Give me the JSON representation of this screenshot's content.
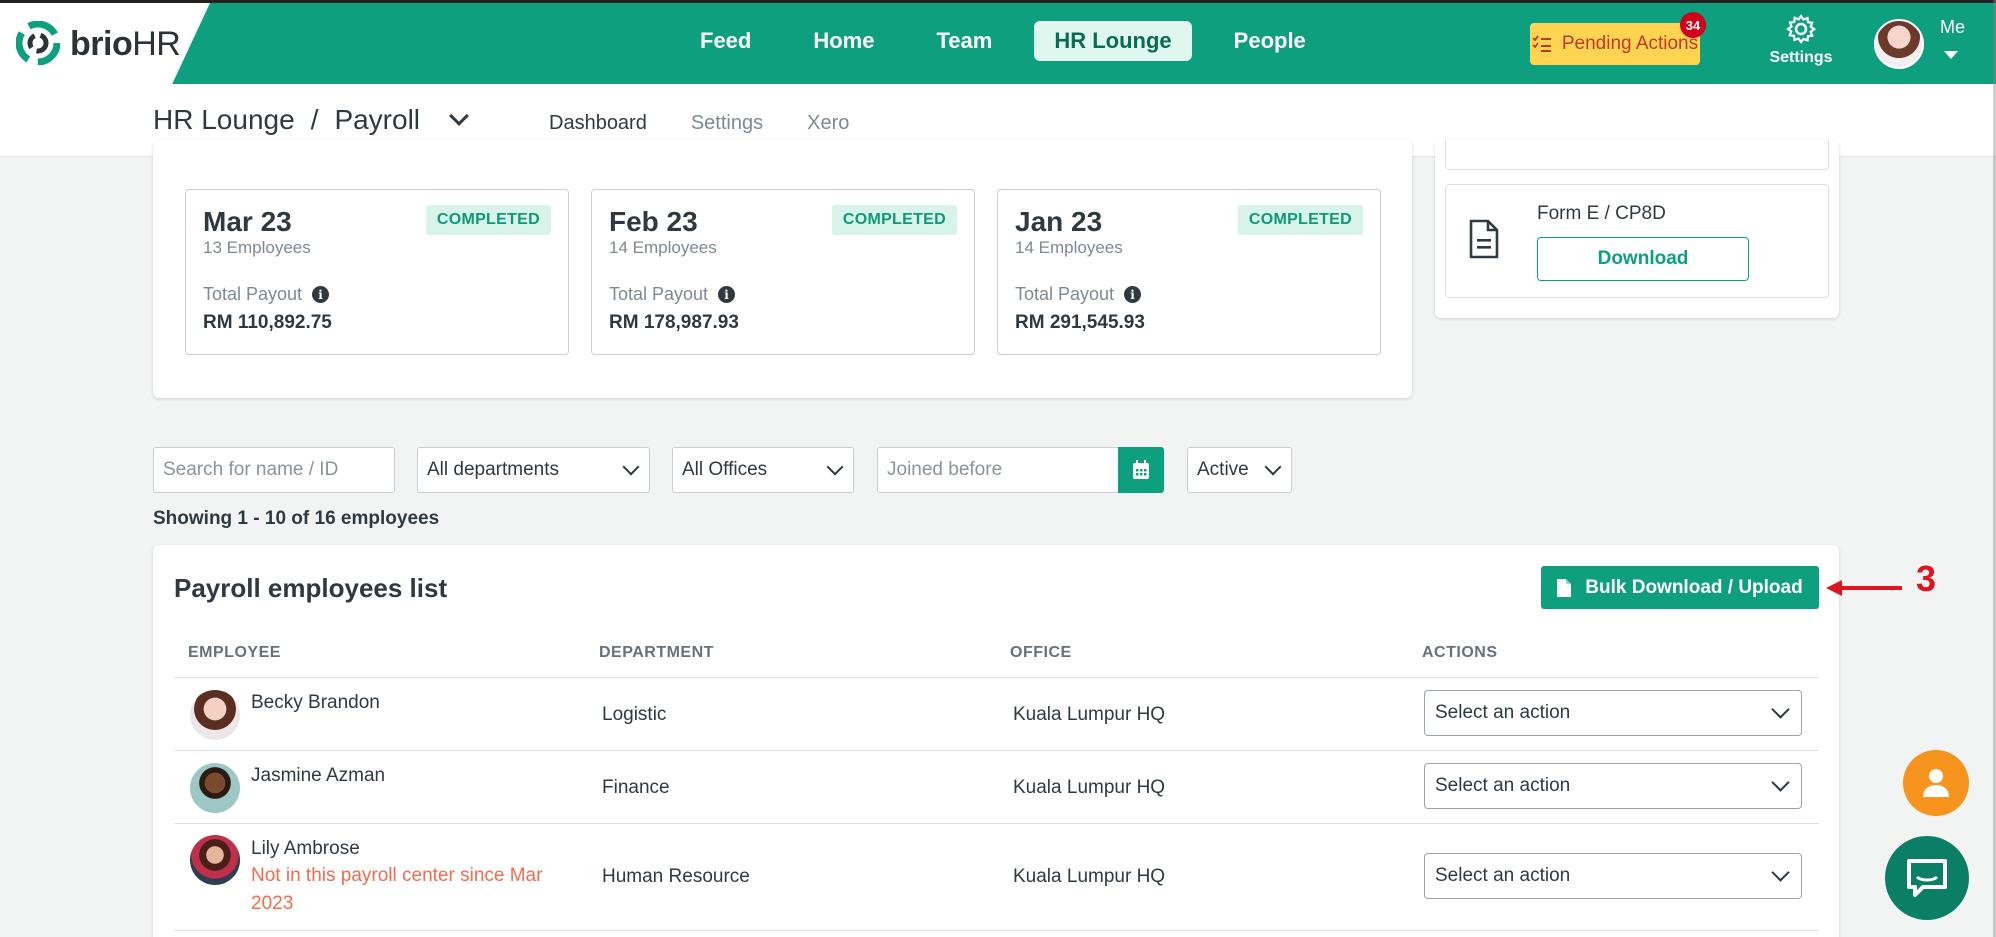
{
  "brand": {
    "name_bold": "brio",
    "name_rest": "HR"
  },
  "nav": {
    "items": [
      "Feed",
      "Home",
      "Team",
      "HR Lounge",
      "People"
    ],
    "active": "HR Lounge"
  },
  "pending_actions": {
    "label": "Pending Actions",
    "count": "34"
  },
  "settings": {
    "label": "Settings"
  },
  "me": {
    "label": "Me"
  },
  "breadcrumb": {
    "section": "HR Lounge",
    "separator": "/",
    "page": "Payroll"
  },
  "subtabs": [
    "Dashboard",
    "Settings",
    "Xero"
  ],
  "subtab_active": "Dashboard",
  "payroll_months": [
    {
      "title": "Mar 23",
      "employees": "13 Employees",
      "status": "COMPLETED",
      "payout_label": "Total Payout",
      "payout": "RM 110,892.75"
    },
    {
      "title": "Feb 23",
      "employees": "14 Employees",
      "status": "COMPLETED",
      "payout_label": "Total Payout",
      "payout": "RM 178,987.93"
    },
    {
      "title": "Jan 23",
      "employees": "14 Employees",
      "status": "COMPLETED",
      "payout_label": "Total Payout",
      "payout": "RM 291,545.93"
    }
  ],
  "forms": {
    "title": "Form E / CP8D",
    "download_label": "Download"
  },
  "filters": {
    "search_placeholder": "Search for name / ID",
    "department": "All departments",
    "office": "All Offices",
    "joined_placeholder": "Joined before",
    "status": "Active"
  },
  "showing": "Showing 1 - 10 of 16 employees",
  "list": {
    "title": "Payroll employees list",
    "bulk_label": "Bulk Download / Upload",
    "annotation": "3",
    "columns": [
      "EMPLOYEE",
      "DEPARTMENT",
      "OFFICE",
      "ACTIONS"
    ],
    "rows": [
      {
        "name": "Becky Brandon",
        "note": "",
        "department": "Logistic",
        "office": "Kuala Lumpur HQ",
        "action": "Select an action"
      },
      {
        "name": "Jasmine Azman",
        "note": "",
        "department": "Finance",
        "office": "Kuala Lumpur HQ",
        "action": "Select an action"
      },
      {
        "name": "Lily Ambrose",
        "note_line1": "Not in this payroll center since Mar",
        "note_line2": "2023",
        "department": "Human Resource",
        "office": "Kuala Lumpur HQ",
        "action": "Select an action"
      }
    ]
  },
  "colors": {
    "brand_green": "#0ea07e",
    "pending_yellow": "#ffd451",
    "badge_red": "#d0021b",
    "warn": "#f26b4c",
    "fab_orange": "#f7941d",
    "annotation_red": "#e0141e"
  },
  "icons": [
    "logo-swirl-icon",
    "checklist-icon",
    "gear-icon",
    "chevron-down-icon",
    "info-icon",
    "document-icon",
    "calendar-icon",
    "file-icon",
    "arrow-left-icon",
    "user-icon",
    "chat-icon"
  ]
}
